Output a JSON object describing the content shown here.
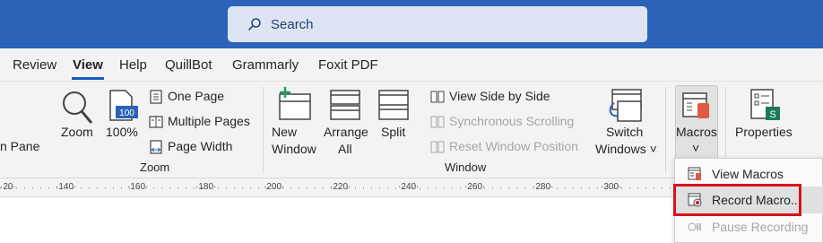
{
  "search": {
    "label": "Search"
  },
  "tabs": [
    {
      "label": "Review"
    },
    {
      "label": "View"
    },
    {
      "label": "Help"
    },
    {
      "label": "QuillBot"
    },
    {
      "label": "Grammarly"
    },
    {
      "label": "Foxit PDF"
    }
  ],
  "ribbon": {
    "partial_left": "n Pane",
    "zoom": {
      "zoom_label": "Zoom",
      "hundred_label": "100%",
      "one_page": "One Page",
      "multiple_pages": "Multiple Pages",
      "page_width": "Page Width",
      "group_label": "Zoom"
    },
    "window": {
      "new_window_1": "New",
      "new_window_2": "Window",
      "arrange_1": "Arrange",
      "arrange_2": "All",
      "split": "Split",
      "view_side_by_side": "View Side by Side",
      "sync_scrolling": "Synchronous Scrolling",
      "reset_position": "Reset Window Position",
      "switch_1": "Switch",
      "switch_2": "Windows ˅",
      "group_label": "Window"
    },
    "macros": {
      "label": "Macros",
      "chevron": "˅"
    },
    "properties": {
      "label": "Properties"
    }
  },
  "ruler": {
    "numbers": [
      "·20·",
      "·140·",
      "·160·",
      "·180·",
      "·200·",
      "·220·",
      "·240·",
      "·260·",
      "·280·",
      "·300·"
    ]
  },
  "macros_menu": {
    "items": [
      {
        "label": "View Macros"
      },
      {
        "label": "Record Macro..."
      },
      {
        "label": "Pause Recording"
      }
    ]
  },
  "colors": {
    "titlebar": "#2b63b8",
    "accent": "#185abd",
    "highlight": "#d9121b"
  }
}
